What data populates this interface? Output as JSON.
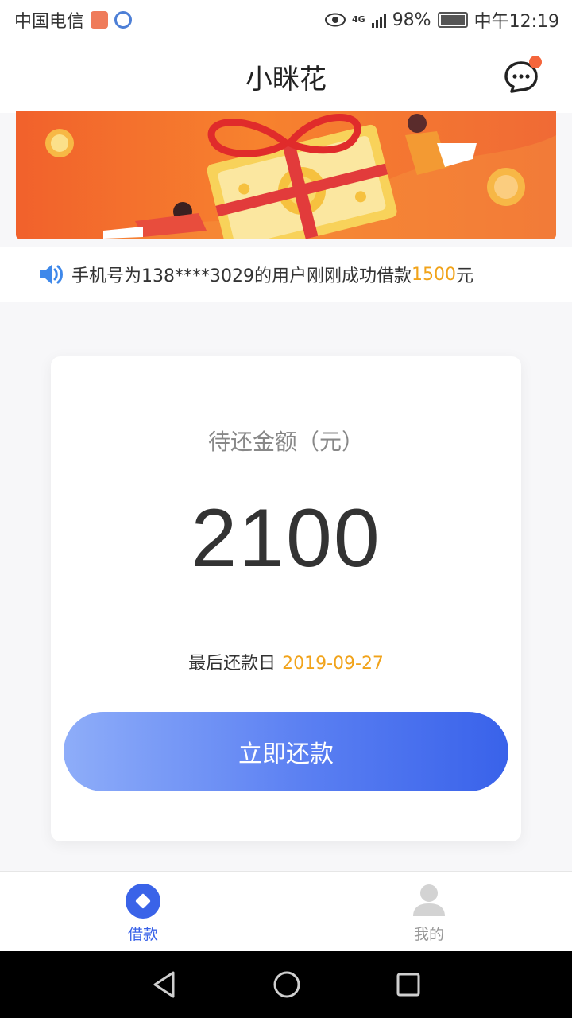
{
  "status_bar": {
    "carrier": "中国电信",
    "battery": "98%",
    "time": "中午12:19",
    "network": "4G"
  },
  "header": {
    "title": "小眯花"
  },
  "notice": {
    "prefix": "手机号为138****3029的用户刚刚成功借款",
    "amount": "1500",
    "suffix": "元"
  },
  "card": {
    "label": "待还金额（元）",
    "amount": "2100",
    "due_label": "最后还款日",
    "due_date": "2019-09-27",
    "button_label": "立即还款"
  },
  "bottom_nav": {
    "items": [
      {
        "label": "借款",
        "icon": "loan-diamond-icon",
        "active": true
      },
      {
        "label": "我的",
        "icon": "user-icon",
        "active": false
      }
    ]
  },
  "colors": {
    "accent": "#3a63e8",
    "highlight": "#f1a31a",
    "banner": "#f1612c",
    "badge": "#f4653b"
  }
}
